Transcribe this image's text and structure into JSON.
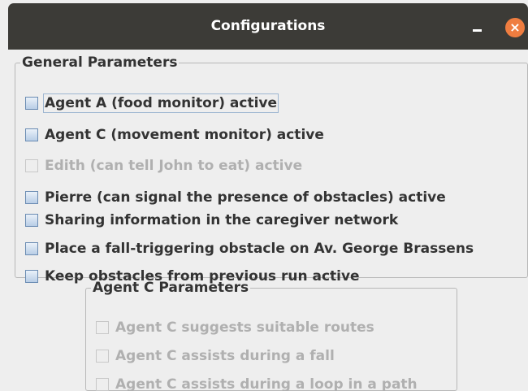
{
  "window": {
    "title": "Configurations",
    "minimize_label": "–",
    "close_label": "×",
    "close_color": "#ef7d40",
    "titlebar_color": "#3c3b37"
  },
  "general_parameters": {
    "legend": "General Parameters",
    "options": [
      {
        "label": "Agent A (food monitor) active",
        "checked": false,
        "enabled": true,
        "focused": true
      },
      {
        "label": "Agent C (movement monitor) active",
        "checked": false,
        "enabled": true,
        "focused": false
      },
      {
        "label": "Edith (can tell John to eat) active",
        "checked": false,
        "enabled": false,
        "focused": false
      },
      {
        "label": "Pierre (can signal the presence of obstacles) active",
        "checked": false,
        "enabled": true,
        "focused": false
      },
      {
        "label": "Sharing information in the caregiver network",
        "checked": false,
        "enabled": true,
        "focused": false
      },
      {
        "label": "Place a fall-triggering obstacle on Av. George Brassens",
        "checked": false,
        "enabled": true,
        "focused": false
      },
      {
        "label": "Keep obstacles from previous run active",
        "checked": false,
        "enabled": true,
        "focused": false
      }
    ]
  },
  "agent_c_parameters": {
    "legend": "Agent C Parameters",
    "options": [
      {
        "label": "Agent C suggests suitable routes",
        "checked": false,
        "enabled": false
      },
      {
        "label": "Agent C assists during a fall",
        "checked": false,
        "enabled": false
      },
      {
        "label": "Agent C assists during a loop in a path",
        "checked": false,
        "enabled": false
      }
    ]
  }
}
